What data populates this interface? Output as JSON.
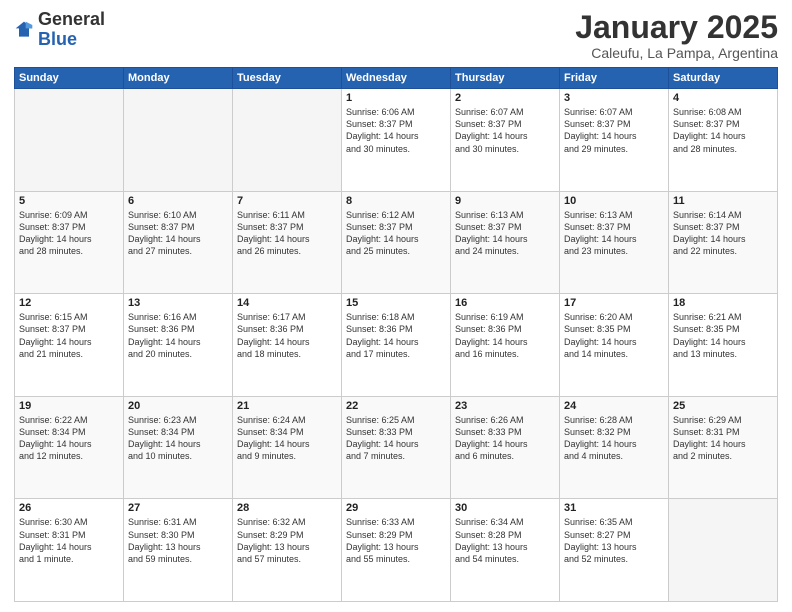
{
  "logo": {
    "general": "General",
    "blue": "Blue"
  },
  "header": {
    "title": "January 2025",
    "subtitle": "Caleufu, La Pampa, Argentina"
  },
  "weekdays": [
    "Sunday",
    "Monday",
    "Tuesday",
    "Wednesday",
    "Thursday",
    "Friday",
    "Saturday"
  ],
  "weeks": [
    [
      {
        "day": "",
        "info": ""
      },
      {
        "day": "",
        "info": ""
      },
      {
        "day": "",
        "info": ""
      },
      {
        "day": "1",
        "info": "Sunrise: 6:06 AM\nSunset: 8:37 PM\nDaylight: 14 hours\nand 30 minutes."
      },
      {
        "day": "2",
        "info": "Sunrise: 6:07 AM\nSunset: 8:37 PM\nDaylight: 14 hours\nand 30 minutes."
      },
      {
        "day": "3",
        "info": "Sunrise: 6:07 AM\nSunset: 8:37 PM\nDaylight: 14 hours\nand 29 minutes."
      },
      {
        "day": "4",
        "info": "Sunrise: 6:08 AM\nSunset: 8:37 PM\nDaylight: 14 hours\nand 28 minutes."
      }
    ],
    [
      {
        "day": "5",
        "info": "Sunrise: 6:09 AM\nSunset: 8:37 PM\nDaylight: 14 hours\nand 28 minutes."
      },
      {
        "day": "6",
        "info": "Sunrise: 6:10 AM\nSunset: 8:37 PM\nDaylight: 14 hours\nand 27 minutes."
      },
      {
        "day": "7",
        "info": "Sunrise: 6:11 AM\nSunset: 8:37 PM\nDaylight: 14 hours\nand 26 minutes."
      },
      {
        "day": "8",
        "info": "Sunrise: 6:12 AM\nSunset: 8:37 PM\nDaylight: 14 hours\nand 25 minutes."
      },
      {
        "day": "9",
        "info": "Sunrise: 6:13 AM\nSunset: 8:37 PM\nDaylight: 14 hours\nand 24 minutes."
      },
      {
        "day": "10",
        "info": "Sunrise: 6:13 AM\nSunset: 8:37 PM\nDaylight: 14 hours\nand 23 minutes."
      },
      {
        "day": "11",
        "info": "Sunrise: 6:14 AM\nSunset: 8:37 PM\nDaylight: 14 hours\nand 22 minutes."
      }
    ],
    [
      {
        "day": "12",
        "info": "Sunrise: 6:15 AM\nSunset: 8:37 PM\nDaylight: 14 hours\nand 21 minutes."
      },
      {
        "day": "13",
        "info": "Sunrise: 6:16 AM\nSunset: 8:36 PM\nDaylight: 14 hours\nand 20 minutes."
      },
      {
        "day": "14",
        "info": "Sunrise: 6:17 AM\nSunset: 8:36 PM\nDaylight: 14 hours\nand 18 minutes."
      },
      {
        "day": "15",
        "info": "Sunrise: 6:18 AM\nSunset: 8:36 PM\nDaylight: 14 hours\nand 17 minutes."
      },
      {
        "day": "16",
        "info": "Sunrise: 6:19 AM\nSunset: 8:36 PM\nDaylight: 14 hours\nand 16 minutes."
      },
      {
        "day": "17",
        "info": "Sunrise: 6:20 AM\nSunset: 8:35 PM\nDaylight: 14 hours\nand 14 minutes."
      },
      {
        "day": "18",
        "info": "Sunrise: 6:21 AM\nSunset: 8:35 PM\nDaylight: 14 hours\nand 13 minutes."
      }
    ],
    [
      {
        "day": "19",
        "info": "Sunrise: 6:22 AM\nSunset: 8:34 PM\nDaylight: 14 hours\nand 12 minutes."
      },
      {
        "day": "20",
        "info": "Sunrise: 6:23 AM\nSunset: 8:34 PM\nDaylight: 14 hours\nand 10 minutes."
      },
      {
        "day": "21",
        "info": "Sunrise: 6:24 AM\nSunset: 8:34 PM\nDaylight: 14 hours\nand 9 minutes."
      },
      {
        "day": "22",
        "info": "Sunrise: 6:25 AM\nSunset: 8:33 PM\nDaylight: 14 hours\nand 7 minutes."
      },
      {
        "day": "23",
        "info": "Sunrise: 6:26 AM\nSunset: 8:33 PM\nDaylight: 14 hours\nand 6 minutes."
      },
      {
        "day": "24",
        "info": "Sunrise: 6:28 AM\nSunset: 8:32 PM\nDaylight: 14 hours\nand 4 minutes."
      },
      {
        "day": "25",
        "info": "Sunrise: 6:29 AM\nSunset: 8:31 PM\nDaylight: 14 hours\nand 2 minutes."
      }
    ],
    [
      {
        "day": "26",
        "info": "Sunrise: 6:30 AM\nSunset: 8:31 PM\nDaylight: 14 hours\nand 1 minute."
      },
      {
        "day": "27",
        "info": "Sunrise: 6:31 AM\nSunset: 8:30 PM\nDaylight: 13 hours\nand 59 minutes."
      },
      {
        "day": "28",
        "info": "Sunrise: 6:32 AM\nSunset: 8:29 PM\nDaylight: 13 hours\nand 57 minutes."
      },
      {
        "day": "29",
        "info": "Sunrise: 6:33 AM\nSunset: 8:29 PM\nDaylight: 13 hours\nand 55 minutes."
      },
      {
        "day": "30",
        "info": "Sunrise: 6:34 AM\nSunset: 8:28 PM\nDaylight: 13 hours\nand 54 minutes."
      },
      {
        "day": "31",
        "info": "Sunrise: 6:35 AM\nSunset: 8:27 PM\nDaylight: 13 hours\nand 52 minutes."
      },
      {
        "day": "",
        "info": ""
      }
    ]
  ]
}
